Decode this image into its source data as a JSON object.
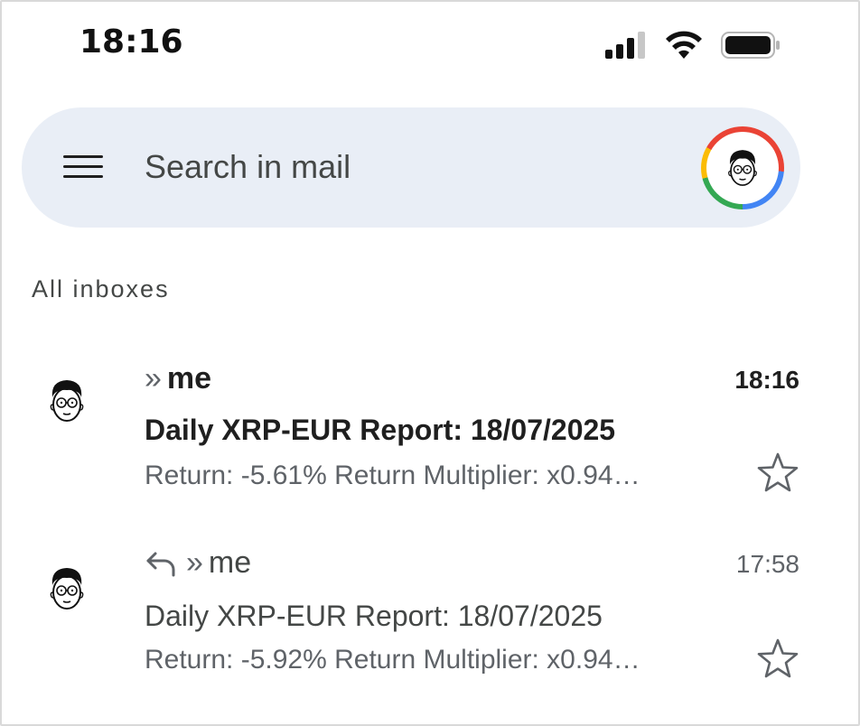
{
  "status_bar": {
    "time": "18:16",
    "icons": [
      "signal-icon",
      "wifi-icon",
      "battery-icon"
    ]
  },
  "search": {
    "placeholder": "Search in mail",
    "menu_icon": "hamburger-menu-icon",
    "avatar": "account-avatar"
  },
  "section": {
    "label": "All inboxes"
  },
  "colors": {
    "search_bg": "#e9eef6",
    "text_primary": "#1f1f1f",
    "text_secondary": "#5f6368",
    "google_red": "#ea4335",
    "google_blue": "#4285f4",
    "google_green": "#34a853",
    "google_yellow": "#fbbc05"
  },
  "emails": [
    {
      "sender": "me",
      "time": "18:16",
      "subject": "Daily XRP-EUR Report: 18/07/2025",
      "snippet": "Return: -5.61% Return Multiplier: x0.94…",
      "unread": true,
      "replied": false,
      "starred": false
    },
    {
      "sender": "me",
      "time": "17:58",
      "subject": "Daily XRP-EUR Report: 18/07/2025",
      "snippet": "Return: -5.92% Return Multiplier: x0.94…",
      "unread": false,
      "replied": true,
      "starred": false
    }
  ]
}
